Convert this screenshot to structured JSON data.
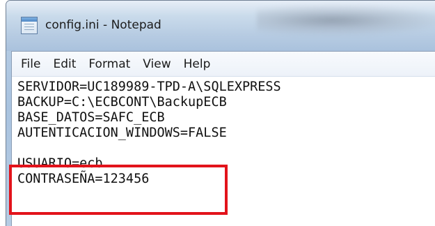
{
  "window": {
    "title": "config.ini - Notepad",
    "icon": "notepad-icon"
  },
  "menu": [
    "File",
    "Edit",
    "Format",
    "View",
    "Help"
  ],
  "editor": {
    "lines": [
      "SERVIDOR=UC189989-TPD-A\\SQLEXPRESS",
      "BACKUP=C:\\ECBCONT\\BackupECB",
      "BASE_DATOS=SAFC_ECB",
      "AUTENTICACION_WINDOWS=FALSE",
      "",
      "USUARIO=ecb",
      "CONTRASEÑA=123456"
    ]
  },
  "highlight": {
    "color": "#e2131b",
    "covers_lines": [
      5,
      6
    ]
  }
}
